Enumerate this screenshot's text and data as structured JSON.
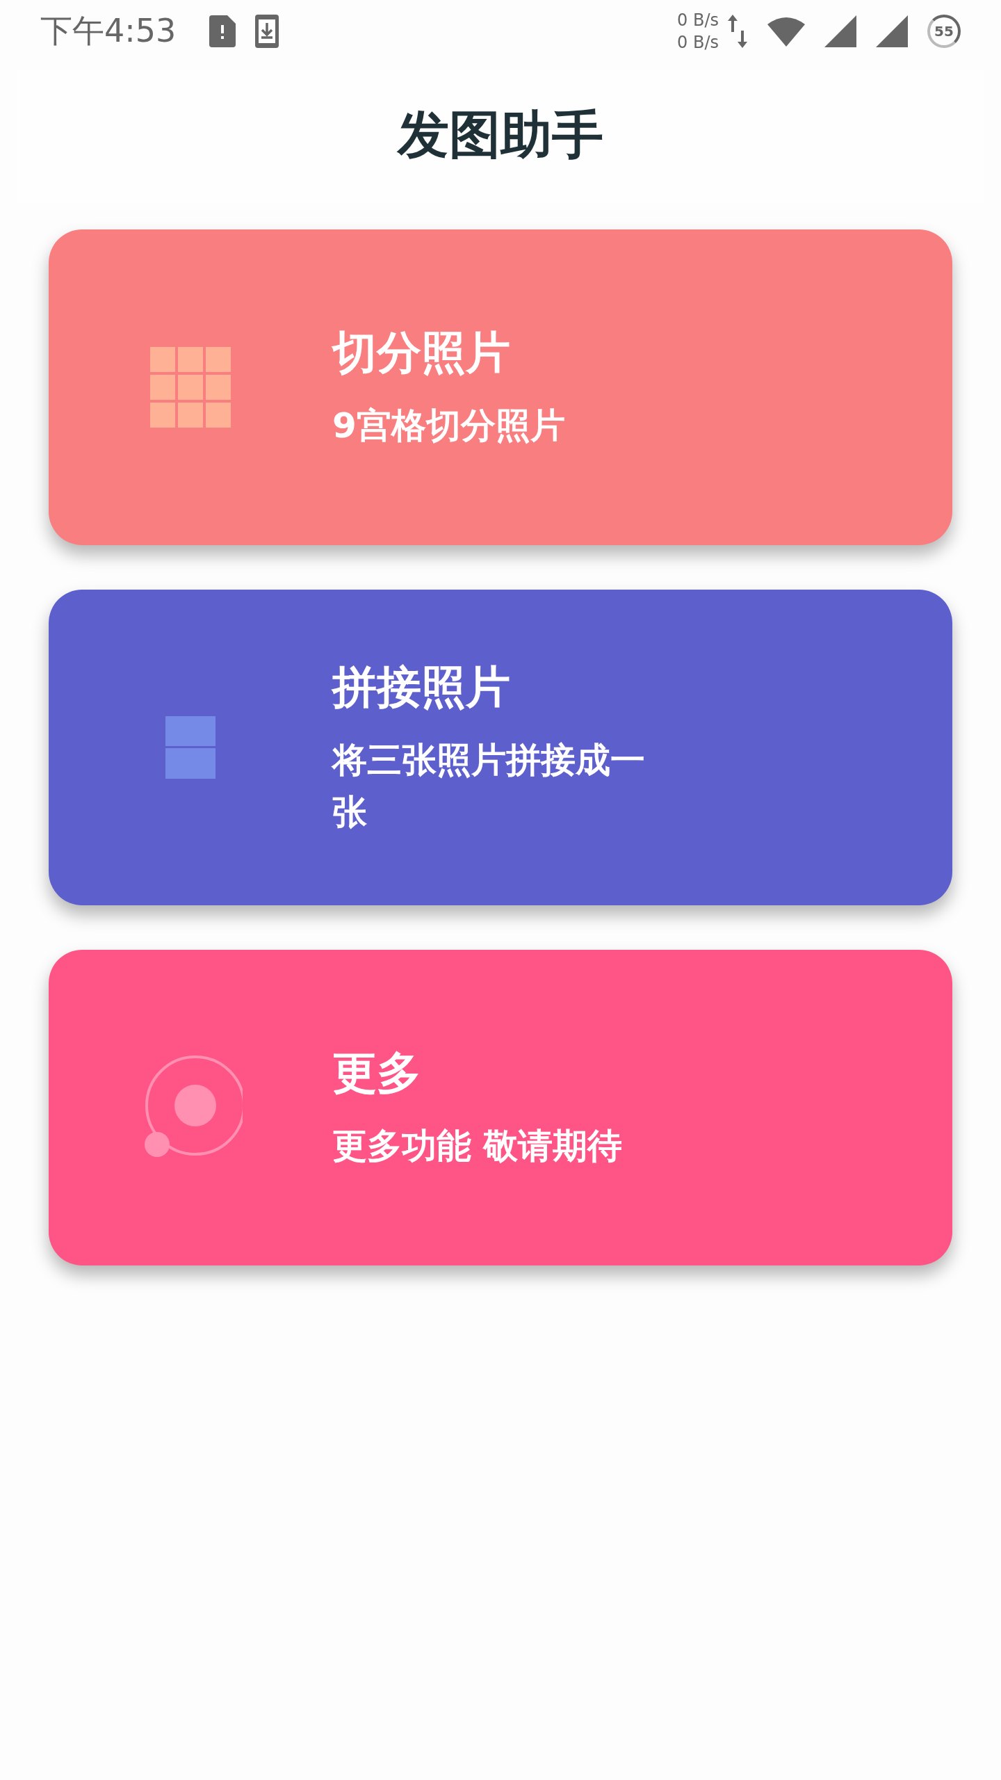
{
  "status_bar": {
    "time": "下午4:53",
    "speed_up": "0 B/s",
    "speed_down": "0 B/s",
    "battery": "55"
  },
  "title": "发图助手",
  "cards": [
    {
      "kind": "grid",
      "title": "切分照片",
      "subtitle": "9宫格切分照片",
      "color": "#f97e80"
    },
    {
      "kind": "stack",
      "title": "拼接照片",
      "subtitle": "将三张照片拼接成一张",
      "color": "#5d5fcd"
    },
    {
      "kind": "orbit",
      "title": "更多",
      "subtitle": "更多功能 敬请期待",
      "color": "#ff5486"
    }
  ]
}
